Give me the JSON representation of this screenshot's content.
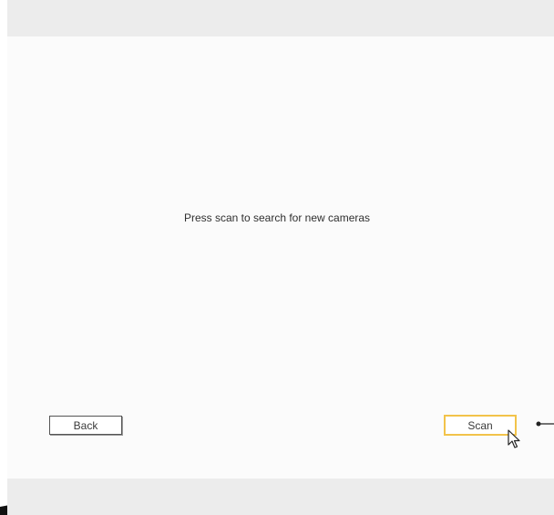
{
  "dialog": {
    "message": "Press scan to search for new cameras"
  },
  "buttons": {
    "back_label": "Back",
    "scan_label": "Scan"
  },
  "colors": {
    "focus_border": "#f2c34a",
    "band_gray": "#ececec",
    "text": "#2f2f2f"
  },
  "icons": {
    "cursor": "mouse-pointer-icon",
    "callout": "callout-line-icon"
  }
}
